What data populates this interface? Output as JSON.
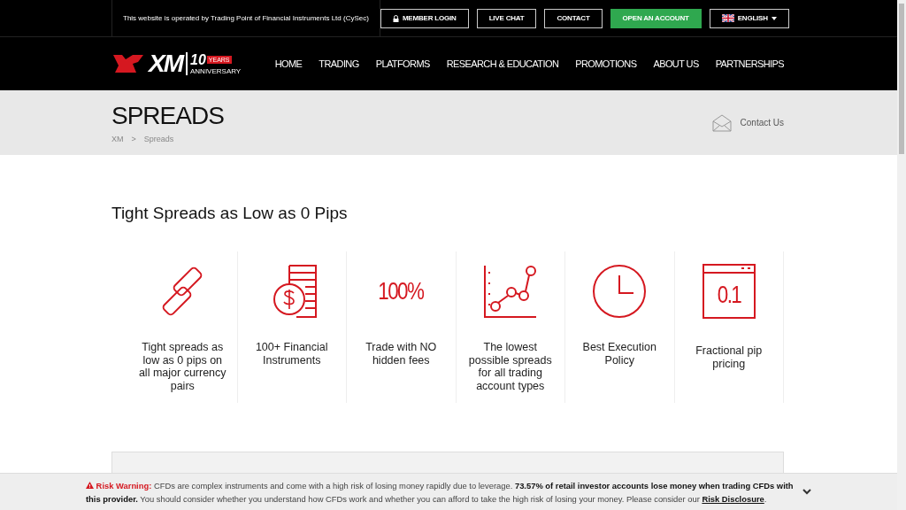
{
  "top_bar": {
    "notice": "This website is operated by Trading Point of Financial Instruments Ltd (CySec)",
    "buttons": [
      {
        "label": "MEMBER LOGIN",
        "kind": "login"
      },
      {
        "label": "LIVE CHAT",
        "kind": "outline"
      },
      {
        "label": "CONTACT",
        "kind": "outline"
      },
      {
        "label": "OPEN AN ACCOUNT",
        "kind": "primary"
      },
      {
        "label": "ENGLISH",
        "kind": "language"
      }
    ]
  },
  "logo": {
    "text": "XM",
    "badge": "10",
    "badge_label": "YEARS",
    "sub": "ANNIVERSARY"
  },
  "nav": [
    "HOME",
    "TRADING",
    "PLATFORMS",
    "RESEARCH & EDUCATION",
    "PROMOTIONS",
    "ABOUT US",
    "PARTNERSHIPS"
  ],
  "page_header": {
    "title": "SPREADS",
    "breadcrumb": [
      "XM",
      "Spreads"
    ],
    "separator": ">",
    "contact": "Contact Us"
  },
  "heading": "Tight Spreads as Low as 0 Pips",
  "features": [
    {
      "kind": "chain",
      "text": "Tight spreads as low as 0 pips on all major currency pairs"
    },
    {
      "kind": "coins",
      "text": "100+ Financial Instruments"
    },
    {
      "kind": "percent",
      "icon_text": "100%",
      "text": "Trade with NO hidden fees"
    },
    {
      "kind": "chart",
      "text": "The lowest possible spreads for all trading account types"
    },
    {
      "kind": "clock",
      "text": "Best Execution Policy"
    },
    {
      "kind": "window",
      "icon_text": "0.1",
      "text": "Fractional pip pricing"
    }
  ],
  "risk_warning": {
    "label": "Risk Warning:",
    "text": "CFDs are complex instruments and come with a high risk of losing money rapidly due to leverage. **73.57% of retail investor accounts lose money when trading CFDs with this provider.** You should consider whether you understand how CFDs work and whether you can afford to take the high risk of losing your money. Please consider our",
    "link": "Risk Disclosure",
    "end": "."
  }
}
